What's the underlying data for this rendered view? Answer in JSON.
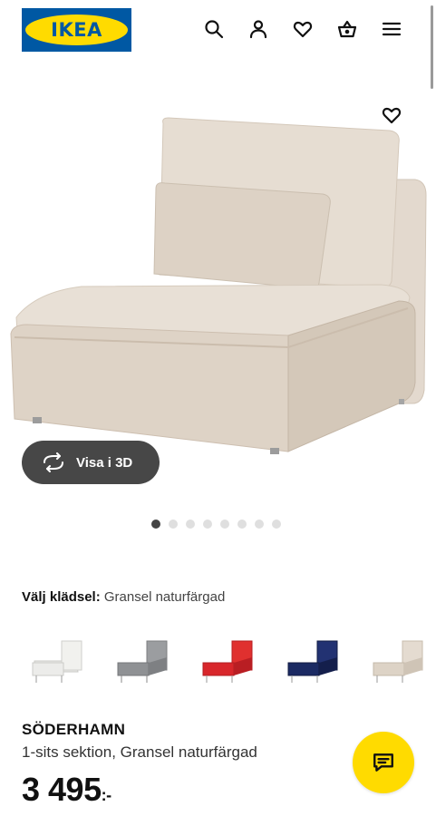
{
  "header": {
    "logo_text": "IKEA",
    "icons": [
      "search-icon",
      "user-icon",
      "heart-icon",
      "cart-icon",
      "menu-icon"
    ]
  },
  "hero": {
    "view_3d_label": "Visa i 3D",
    "carousel": {
      "total": 8,
      "active": 1
    }
  },
  "fabric": {
    "label": "Välj klädsel:",
    "value": "Gransel naturfärgad",
    "swatches": [
      {
        "name": "white",
        "color": "#ececea"
      },
      {
        "name": "grey",
        "color": "#8f9194"
      },
      {
        "name": "red",
        "color": "#d8262b"
      },
      {
        "name": "dark-blue",
        "color": "#1b2a63"
      },
      {
        "name": "natural",
        "color": "#ddd3c6"
      }
    ]
  },
  "product": {
    "name": "SÖDERHAMN",
    "description": "1-sits sektion, Gransel naturfärgad",
    "price": "3 495",
    "price_suffix": ":-"
  },
  "colors": {
    "ikea_blue": "#0058a3",
    "ikea_yellow": "#ffdb00",
    "pill_bg": "#474747"
  }
}
